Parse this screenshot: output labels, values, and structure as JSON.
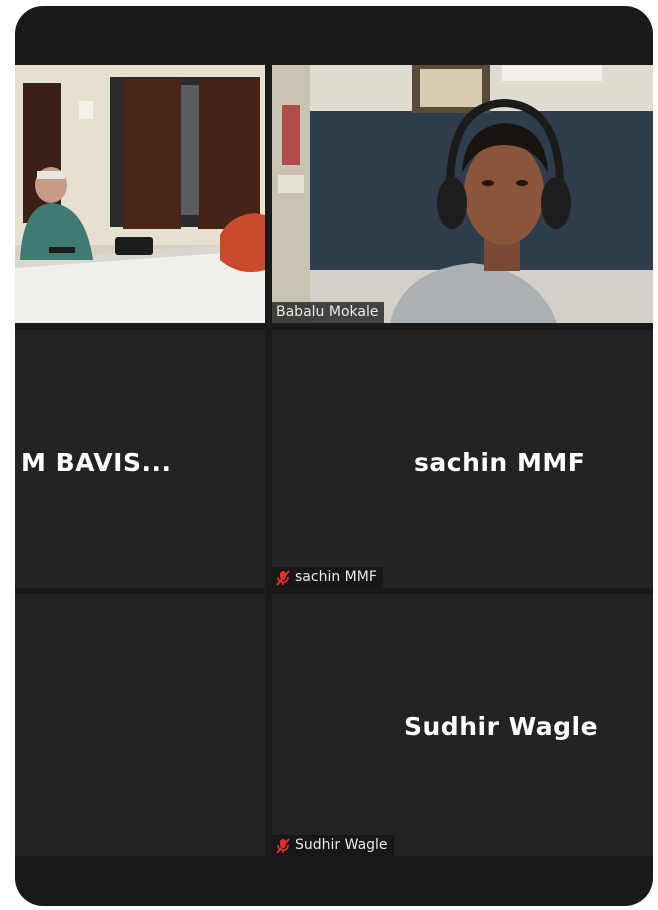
{
  "participants": {
    "room": {
      "label": ""
    },
    "babalu": {
      "name_tag": "Babalu Mokale"
    },
    "bavis": {
      "display_name": "M  BAVIS..."
    },
    "sachin": {
      "display_name": "sachin MMF",
      "name_tag": "sachin MMF",
      "muted": true
    },
    "sudhir": {
      "display_name": "Sudhir Wagle",
      "name_tag": "Sudhir Wagle",
      "muted": true
    }
  },
  "icons": {
    "muted_mic": "muted-mic-icon"
  },
  "colors": {
    "tile_bg": "#232323",
    "frame_bg": "#1a1a1a",
    "muted_icon": "#e0302f",
    "name_text": "#ffffff"
  }
}
